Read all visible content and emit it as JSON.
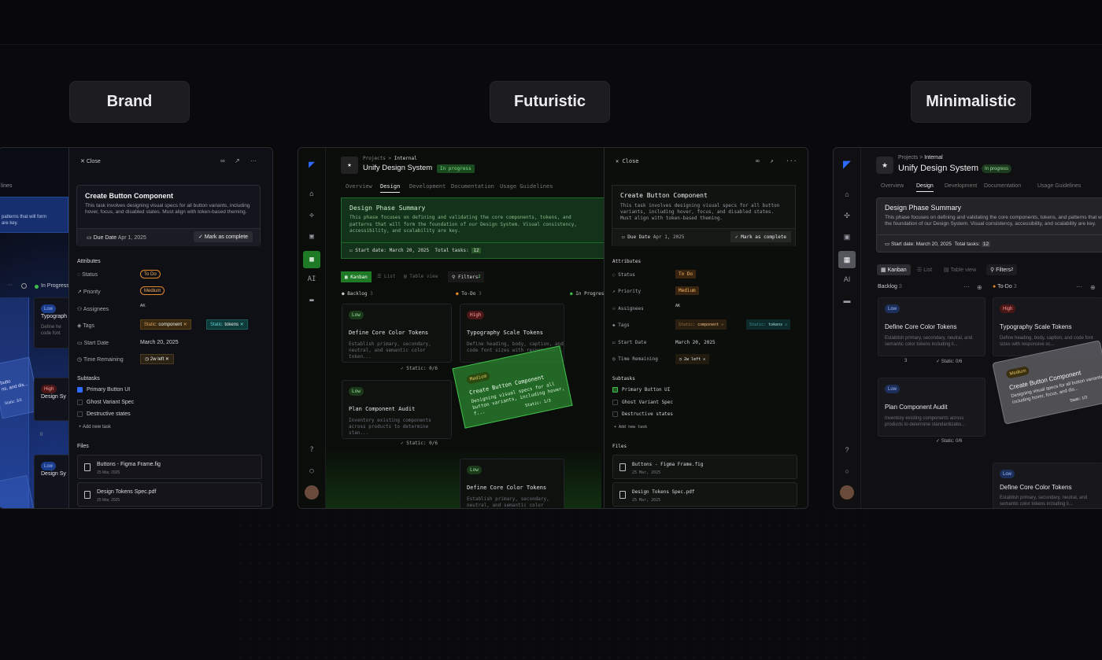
{
  "labels": [
    "Brand",
    "Futuristic",
    "Minimalistic"
  ],
  "project": {
    "crumb_root": "Projects",
    "crumb_sep": ">",
    "crumb_child": "Internal",
    "title": "Unify Design System",
    "status": "In progress"
  },
  "tabs": [
    "Overview",
    "Design",
    "Development",
    "Documentation",
    "Usage Guidelines"
  ],
  "summary": {
    "title": "Design Phase Summary",
    "text_sans": "This phase focuses on defining and validating the core components, tokens, and patterns that will form the foundation of our Design System. Visual consistency, accessibility, and scalability are key.",
    "text_mono": "This phase focuses on defining and validating the core components, tokens, and patterns that will form the foundation of our Design System. Visual consistency, accessibility, and scalability are key.",
    "start_sans": "Start date: March 20, 2025",
    "start_mono": "Start date: March 20, 2025",
    "total_label": "Total tasks:",
    "total": "12",
    "total_mono": "12"
  },
  "views": {
    "kanban": "Kanban",
    "list": "List",
    "table": "Table view",
    "filters": "Filters",
    "filters_count": "2"
  },
  "columns": {
    "backlog": "Backlog",
    "backlog_count": "3",
    "todo": "To-Do",
    "todo_count": "3",
    "todo_f": "To-Do",
    "inprogress": "In Progress",
    "inprogress_f": "In Progress"
  },
  "cards": {
    "core": {
      "badge": "Low",
      "title": "Define Core Color Tokens",
      "desc": "Establish primary, secondary, neutral, and semantic color tokens including li...",
      "desc_f": "Establish primary, secondary, neutral, and semantic color token..."
    },
    "typo": {
      "badge": "High",
      "title": "Typography Scale Tokens",
      "desc": "Define heading, body, caption, and code font sizes with responsive sc...",
      "desc_f": "Define heading, body, caption, and code font sizes with responsive..."
    },
    "audit": {
      "badge": "Low",
      "title": "Plan Component Audit",
      "desc": "Inventory existing components across products to determine standardizatio...",
      "desc_f": "Inventory existing components across products to determine stan..."
    },
    "drag": {
      "badge": "Medium",
      "title": "Create Button Component",
      "desc": "Designing visual specs for all button variants, including hover, focus, and dis...",
      "desc_f": "Designing visual specs for all button variants, including hover, f..."
    },
    "static": "Static: 0/6",
    "static_f": "Static: 0/6",
    "static_drag": "Static: 1/3",
    "count3": "3",
    "count0": "0"
  },
  "detail": {
    "close": "Close",
    "task_title": "Create Button Component",
    "task_desc": "This task involves designing visual specs for all button variants, including hover, focus, and disabled states. Must align with token-based theming.",
    "due_label": "Due Date",
    "due": "Apr 1, 2025",
    "due_f": "Apr 1, 2025",
    "mark": "Mark as complete",
    "attributes": "Attributes",
    "status_label": "Status",
    "status": "To Do",
    "priority_label": "Priority",
    "priority": "Medium",
    "assignees_label": "Assignees",
    "assignees_initials": "AK",
    "tags_label": "Tags",
    "tag1_prefix": "Static:",
    "tag1": "component",
    "tag2_prefix": "Static:",
    "tag2": "tokens",
    "start_label": "Start Date",
    "start": "March 20, 2025",
    "start_f": "March 20, 2025",
    "time_label": "Time Remaining",
    "time": "2w left",
    "subtasks": "Subtasks",
    "sub1": "Primary Button UI",
    "sub2": "Ghost Variant Spec",
    "sub3": "Destructive states",
    "add_task": "Add new task",
    "files": "Files",
    "file1": "Buttons - Figma Frame.fig",
    "file1_date": "25 Mar, 2025",
    "file2": "Design Tokens Spec.pdf",
    "file2_date": "25 Mar, 2025"
  },
  "brand_left": {
    "partial1": "patterns that will form",
    "partial2": "are key.",
    "gl": "lines",
    "inprog": "In Progress",
    "typo": "Typograph",
    "low": "Low",
    "high": "High",
    "define": "Define he",
    "code": "code font",
    "design_s": "Design Sy",
    "static": "Static: 3/3",
    "butt": "butto",
    "ns": "ns, and dis...",
    "zero": "0"
  },
  "sidebar_ai": "AI",
  "colors": {
    "green": "#3fbf4a",
    "blue": "#2d6bff",
    "orange": "#e08a2a",
    "red": "#e25555"
  }
}
